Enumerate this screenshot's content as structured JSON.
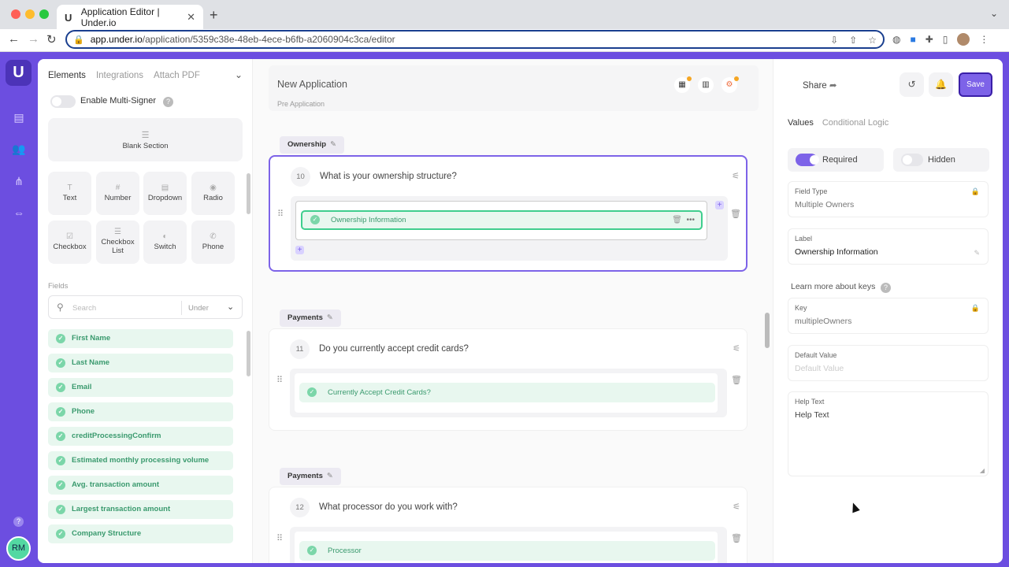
{
  "browser": {
    "tab_title": "Application Editor | Under.io",
    "tab_favicon": "U",
    "url_host": "app.under.io",
    "url_path": "/application/5359c38e-48eb-4ece-b6fb-a2060904c3ca/editor"
  },
  "rail": {
    "logo": "U",
    "help": "?",
    "user_initials": "RM"
  },
  "left_panel": {
    "tabs": [
      "Elements",
      "Integrations",
      "Attach PDF"
    ],
    "multi_signer_label": "Enable Multi-Signer",
    "blank_section": "Blank Section",
    "elements": [
      {
        "label": "Text",
        "icon": "text-icon"
      },
      {
        "label": "Number",
        "icon": "number-icon"
      },
      {
        "label": "Dropdown",
        "icon": "dropdown-icon"
      },
      {
        "label": "Radio",
        "icon": "radio-icon"
      },
      {
        "label": "Checkbox",
        "icon": "checkbox-icon"
      },
      {
        "label": "Checkbox List",
        "icon": "checkbox-list-icon"
      },
      {
        "label": "Switch",
        "icon": "switch-icon"
      },
      {
        "label": "Phone",
        "icon": "phone-icon"
      }
    ],
    "fields_label": "Fields",
    "search_placeholder": "Search",
    "search_scope": "Under",
    "fields": [
      "First Name",
      "Last Name",
      "Email",
      "Phone",
      "creditProcessingConfirm",
      "Estimated monthly processing volume",
      "Avg. transaction amount",
      "Largest transaction amount",
      "Company Structure"
    ]
  },
  "center": {
    "app_title": "New Application",
    "app_subtitle": "Pre Application",
    "sections": [
      {
        "tag": "Ownership",
        "num": "10",
        "question": "What is your ownership structure?",
        "field": "Ownership Information"
      },
      {
        "tag": "Payments",
        "num": "11",
        "question": "Do you currently accept credit cards?",
        "field": "Currently Accept Credit Cards?"
      },
      {
        "tag": "Payments",
        "num": "12",
        "question": "What processor do you work with?",
        "field": "Processor"
      }
    ]
  },
  "right_panel": {
    "share": "Share",
    "save": "Save",
    "tabs": [
      "Values",
      "Conditional Logic"
    ],
    "required_label": "Required",
    "required_on": true,
    "hidden_label": "Hidden",
    "hidden_on": false,
    "field_type_label": "Field Type",
    "field_type_value": "Multiple Owners",
    "label_label": "Label",
    "label_value": "Ownership Information",
    "learn_more": "Learn more about keys",
    "key_label": "Key",
    "key_value": "multipleOwners",
    "default_label": "Default Value",
    "default_placeholder": "Default Value",
    "help_label": "Help Text",
    "help_value": "Help Text"
  },
  "colors": {
    "accent": "#7d63e8",
    "field_green": "#3a9a6e",
    "field_bg": "#e8f7ef"
  }
}
